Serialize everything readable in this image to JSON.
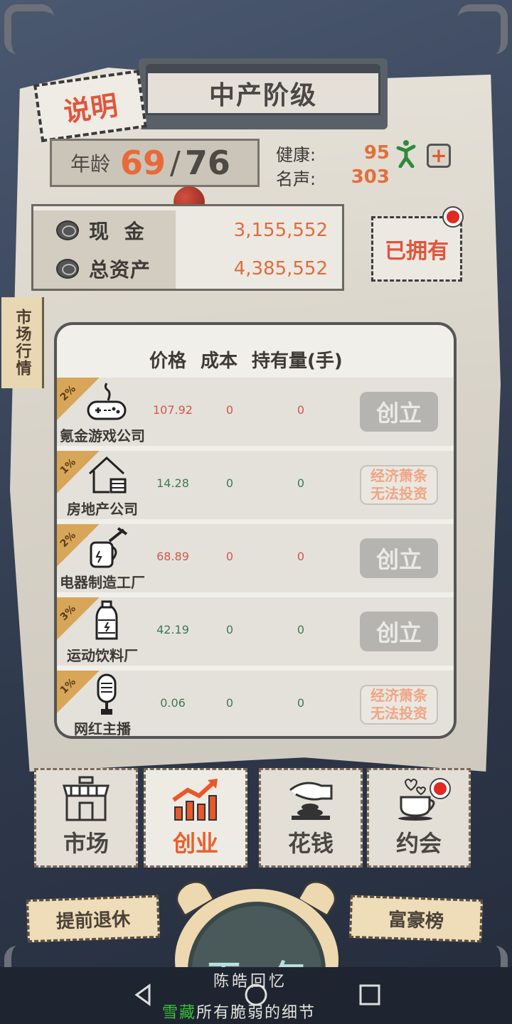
{
  "header": {
    "explain_label": "说明",
    "class_title": "中产阶级"
  },
  "age": {
    "label": "年龄",
    "current": "69",
    "separator": "/",
    "max": "76"
  },
  "stats": {
    "health_label": "健康:",
    "health_value": "95",
    "fame_label": "名声:",
    "fame_value": "303"
  },
  "money": {
    "cash_label": "现 金",
    "cash_value": "3,155,552",
    "assets_label": "总资产",
    "assets_value": "4,385,552"
  },
  "owned_button": "已拥有",
  "side_tab": "市场行情",
  "market": {
    "headers": [
      "价格",
      "成本",
      "持有量(手)"
    ],
    "rows": [
      {
        "rate": "2%",
        "name": "氪金游戏公司",
        "icon": "gamepad-icon",
        "price": "107.92",
        "price_color": "#d0574a",
        "cost": "0",
        "hold": "0",
        "action": "创立",
        "action_type": "found"
      },
      {
        "rate": "1%",
        "name": "房地产公司",
        "icon": "house-icon",
        "price": "14.28",
        "price_color": "#3f7a52",
        "cost": "0",
        "hold": "0",
        "action": "经济萧条无法投资",
        "action_line1": "经济萧条",
        "action_line2": "无法投资",
        "action_type": "blocked"
      },
      {
        "rate": "2%",
        "name": "电器制造工厂",
        "icon": "kettle-hammer-icon",
        "price": "68.89",
        "price_color": "#d0574a",
        "cost": "0",
        "hold": "0",
        "action": "创立",
        "action_type": "found"
      },
      {
        "rate": "3%",
        "name": "运动饮料厂",
        "icon": "bottle-icon",
        "price": "42.19",
        "price_color": "#3f7a52",
        "cost": "0",
        "hold": "0",
        "action": "创立",
        "action_type": "found"
      },
      {
        "rate": "1%",
        "name": "网红主播",
        "icon": "microphone-icon",
        "price": "0.06",
        "price_color": "#3f7a52",
        "cost": "0",
        "hold": "0",
        "action": "经济萧条无法投资",
        "action_line1": "经济萧条",
        "action_line2": "无法投资",
        "action_type": "blocked"
      }
    ]
  },
  "tabs": [
    {
      "label": "市场",
      "icon": "shop-icon",
      "active": false
    },
    {
      "label": "创业",
      "icon": "chart-up-icon",
      "active": true
    },
    {
      "label": "花钱",
      "icon": "hand-coin-icon",
      "active": false
    },
    {
      "label": "约会",
      "icon": "coffee-heart-icon",
      "active": false
    }
  ],
  "bottom": {
    "retire_label": "提前退休",
    "next_year_label": "下一年",
    "rich_list_label": "富豪榜"
  },
  "watermark": {
    "line1": "陈皓回忆",
    "line2_green": "雪藏",
    "line2_rest": "所有脆弱的细节"
  },
  "colors": {
    "accent_orange": "#e86a3a",
    "price_up": "#d0574a",
    "price_down": "#3f7a52"
  }
}
